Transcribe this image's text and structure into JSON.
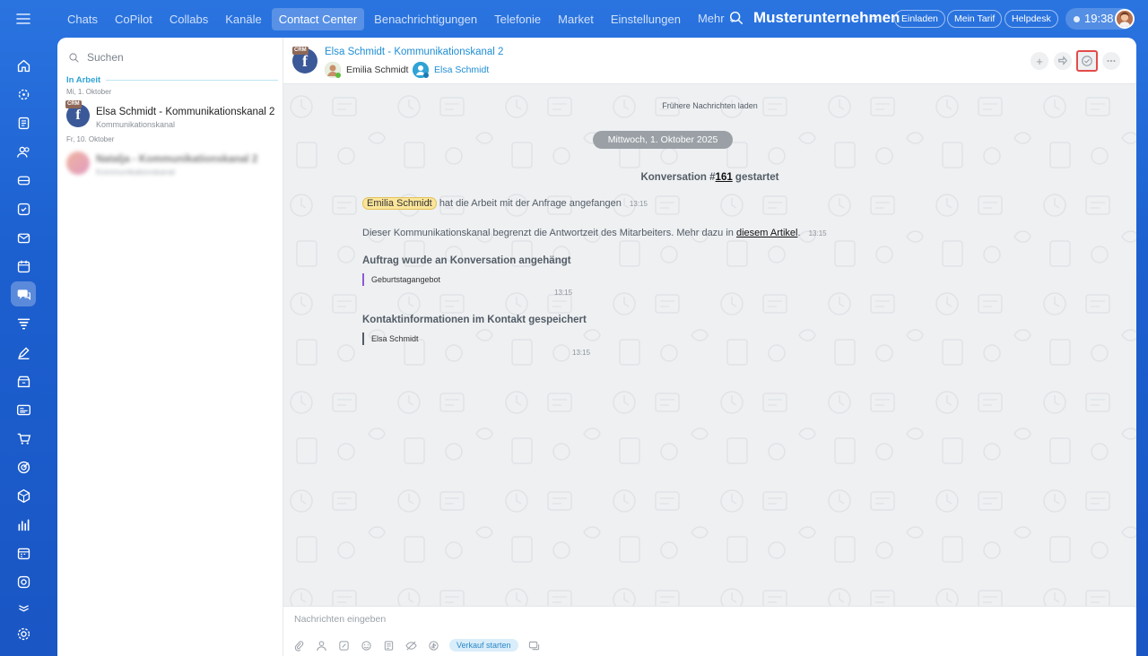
{
  "nav": {
    "tabs": [
      {
        "label": "Chats"
      },
      {
        "label": "CoPilot"
      },
      {
        "label": "Collabs"
      },
      {
        "label": "Kanäle"
      },
      {
        "label": "Contact Center"
      },
      {
        "label": "Benachrichtigungen"
      },
      {
        "label": "Telefonie"
      },
      {
        "label": "Market"
      },
      {
        "label": "Einstellungen"
      },
      {
        "label": "Mehr ⌄"
      }
    ],
    "active_tab": "Contact Center",
    "company": "Musterunternehmen",
    "company_suffix": "≈",
    "invite": "Einladen",
    "plan": "Mein Tarif",
    "helpdesk": "Helpdesk",
    "time": "19:38"
  },
  "sidebar": {
    "icons": [
      "menu-icon",
      "home-icon",
      "copilot-icon",
      "feed-icon",
      "contacts-icon",
      "crm-icon",
      "tasks-icon",
      "mail-icon",
      "calendar-icon",
      "contact-center-icon",
      "funnel-icon",
      "sign-icon",
      "inventory-icon",
      "sites-icon",
      "shop-icon",
      "marketing-icon",
      "store-icon",
      "analytics-icon",
      "booking-icon",
      "automation-icon",
      "tools-icon",
      "settings-icon"
    ]
  },
  "list": {
    "search_placeholder": "Suchen",
    "section": "In Arbeit",
    "groups": [
      {
        "date": "Mi, 1. Oktober",
        "items": [
          {
            "title": "Elsa Schmidt - Kommunikationskanal 2",
            "subtitle": "Kommunikationskanal",
            "badge": "CRM",
            "blurred": false
          }
        ]
      },
      {
        "date": "Fr, 10. Oktober",
        "items": [
          {
            "title": "Natalja - Kommunikationskanal 2",
            "subtitle": "Kommunikationskanal",
            "badge": "",
            "blurred": true
          }
        ]
      }
    ]
  },
  "chat": {
    "header": {
      "badge": "CRM",
      "title": "Elsa Schmidt - Kommunikationskanal 2",
      "operator": "Emilia Schmidt",
      "client": "Elsa Schmidt",
      "actions": [
        "plus-icon",
        "forward-icon",
        "finish-check-icon",
        "more-icon"
      ]
    },
    "load_earlier": "Frühere Nachrichten laden",
    "date_separator": "Mittwoch, 1. Oktober 2025",
    "conversation": {
      "prefix": "Konversation #",
      "number": "161",
      "suffix": " gestartet"
    },
    "messages": {
      "start_name": "Emilia Schmidt",
      "start_text": "hat die Arbeit mit der Anfrage angefangen",
      "start_time": "13:15",
      "limit_text": "Dieser Kommunikationskanal begrenzt die Antwortzeit des Mitarbeiters. Mehr dazu in",
      "limit_link": "diesem Artikel",
      "limit_after": ".",
      "limit_time": "13:15",
      "order_title": "Auftrag wurde an Konversation angehängt",
      "order_item": "Geburtstagangebot",
      "order_time": "13:15",
      "contact_title": "Kontaktinformationen im Kontakt gespeichert",
      "contact_item": "Elsa Schmidt",
      "contact_time": "13:15"
    },
    "composer": {
      "placeholder": "Nachrichten eingeben",
      "tools": [
        "attach-icon",
        "user-icon",
        "template-icon",
        "emoji-icon",
        "document-icon",
        "hide-icon",
        "payment-icon"
      ],
      "sale_button": "Verkauf starten",
      "extra_tool": "chat-icon"
    }
  }
}
